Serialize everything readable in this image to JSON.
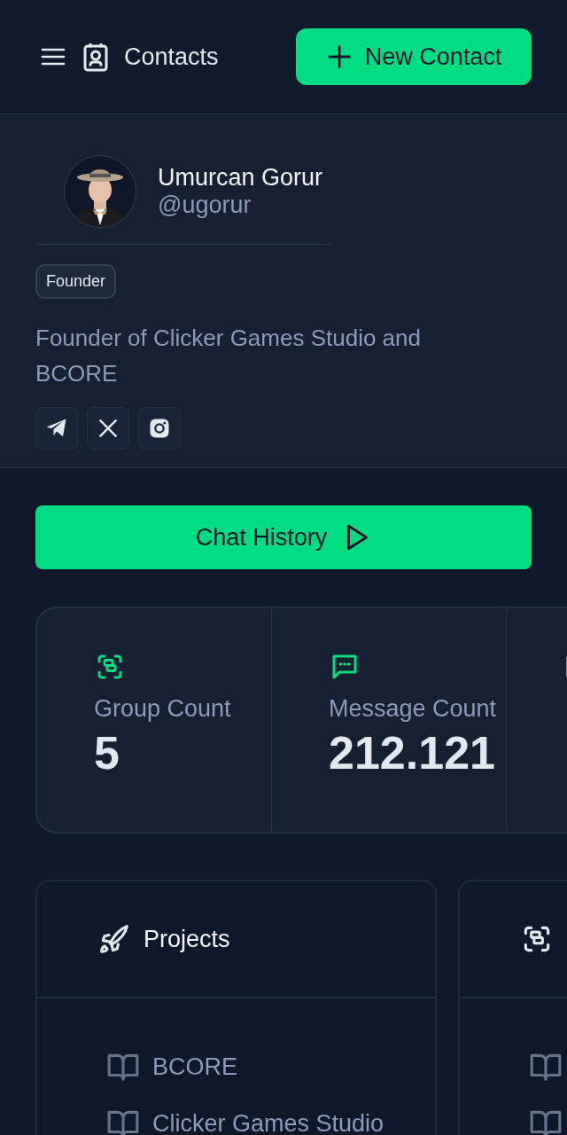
{
  "header": {
    "title": "Contacts",
    "new_button": "New Contact"
  },
  "profile": {
    "name": "Umurcan Gorur",
    "handle": "@ugorur",
    "badge": "Founder",
    "bio": "Founder of Clicker Games Studio and BCORE",
    "socials": [
      {
        "kind": "telegram"
      },
      {
        "kind": "x"
      },
      {
        "kind": "instagram"
      }
    ]
  },
  "chat_button": "Chat History",
  "stats": [
    {
      "kind": "group",
      "label": "Group Count",
      "value": "5"
    },
    {
      "kind": "message",
      "label": "Message Count",
      "value": "212.121"
    },
    {
      "kind": "cut"
    }
  ],
  "panels": [
    {
      "kind": "rocket",
      "title": "Projects",
      "items": [
        {
          "kind": "book",
          "label": "BCORE"
        },
        {
          "kind": "book",
          "label": "Clicker Games Studio"
        }
      ]
    },
    {
      "kind": "group",
      "items": [
        {
          "kind": "book"
        },
        {
          "kind": "book"
        }
      ]
    }
  ]
}
